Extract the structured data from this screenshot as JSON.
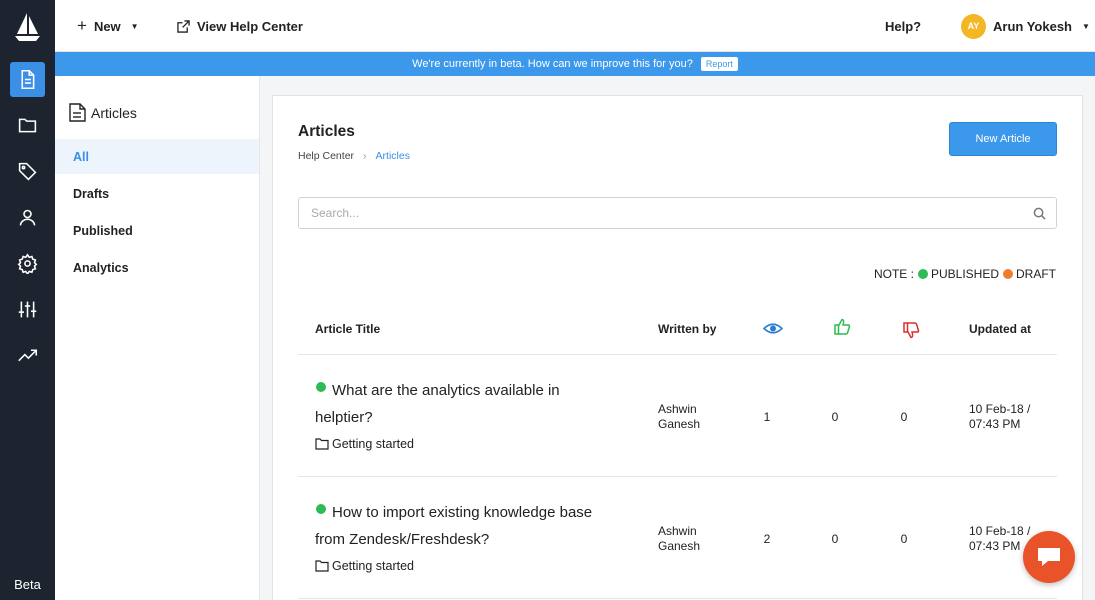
{
  "topbar": {
    "new_label": "New",
    "view_help_label": "View Help Center",
    "help_label": "Help?",
    "user_initials": "AY",
    "user_name": "Arun Yokesh"
  },
  "banner": {
    "text": "We're currently in beta. How can we improve this for you?",
    "report_label": "Report"
  },
  "rail": {
    "icons": [
      "document-icon",
      "folder-icon",
      "tag-icon",
      "user-icon",
      "settings-icon",
      "sliders-icon",
      "trending-icon"
    ],
    "beta_label": "Beta"
  },
  "subnav": {
    "heading": "Articles",
    "items": [
      {
        "label": "All",
        "active": true
      },
      {
        "label": "Drafts"
      },
      {
        "label": "Published"
      },
      {
        "label": "Analytics"
      }
    ]
  },
  "main": {
    "title": "Articles",
    "breadcrumb": [
      "Help Center",
      "Articles"
    ],
    "new_article_label": "New Article",
    "search_placeholder": "Search...",
    "note": {
      "prefix": "NOTE :",
      "published": "PUBLISHED",
      "draft": "DRAFT"
    },
    "columns": {
      "title": "Article Title",
      "written_by": "Written by",
      "updated_at": "Updated at"
    },
    "rows": [
      {
        "title": "What are the analytics available in helptier?",
        "category": "Getting started",
        "author": "Ashwin Ganesh",
        "views": "1",
        "likes": "0",
        "dislikes": "0",
        "updated": "10 Feb-18 / 07:43 PM"
      },
      {
        "title": "How to import existing knowledge base from Zendesk/Freshdesk?",
        "category": "Getting started",
        "author": "Ashwin Ganesh",
        "views": "2",
        "likes": "0",
        "dislikes": "0",
        "updated": "10 Feb-18 / 07:43 PM"
      }
    ]
  },
  "colors": {
    "rail_bg": "#1d2430",
    "accent": "#3b98ea",
    "published": "#2dbb54",
    "draft": "#f07c31",
    "like": "#2dbb54",
    "dislike": "#d9302c",
    "chat": "#e8532a"
  }
}
